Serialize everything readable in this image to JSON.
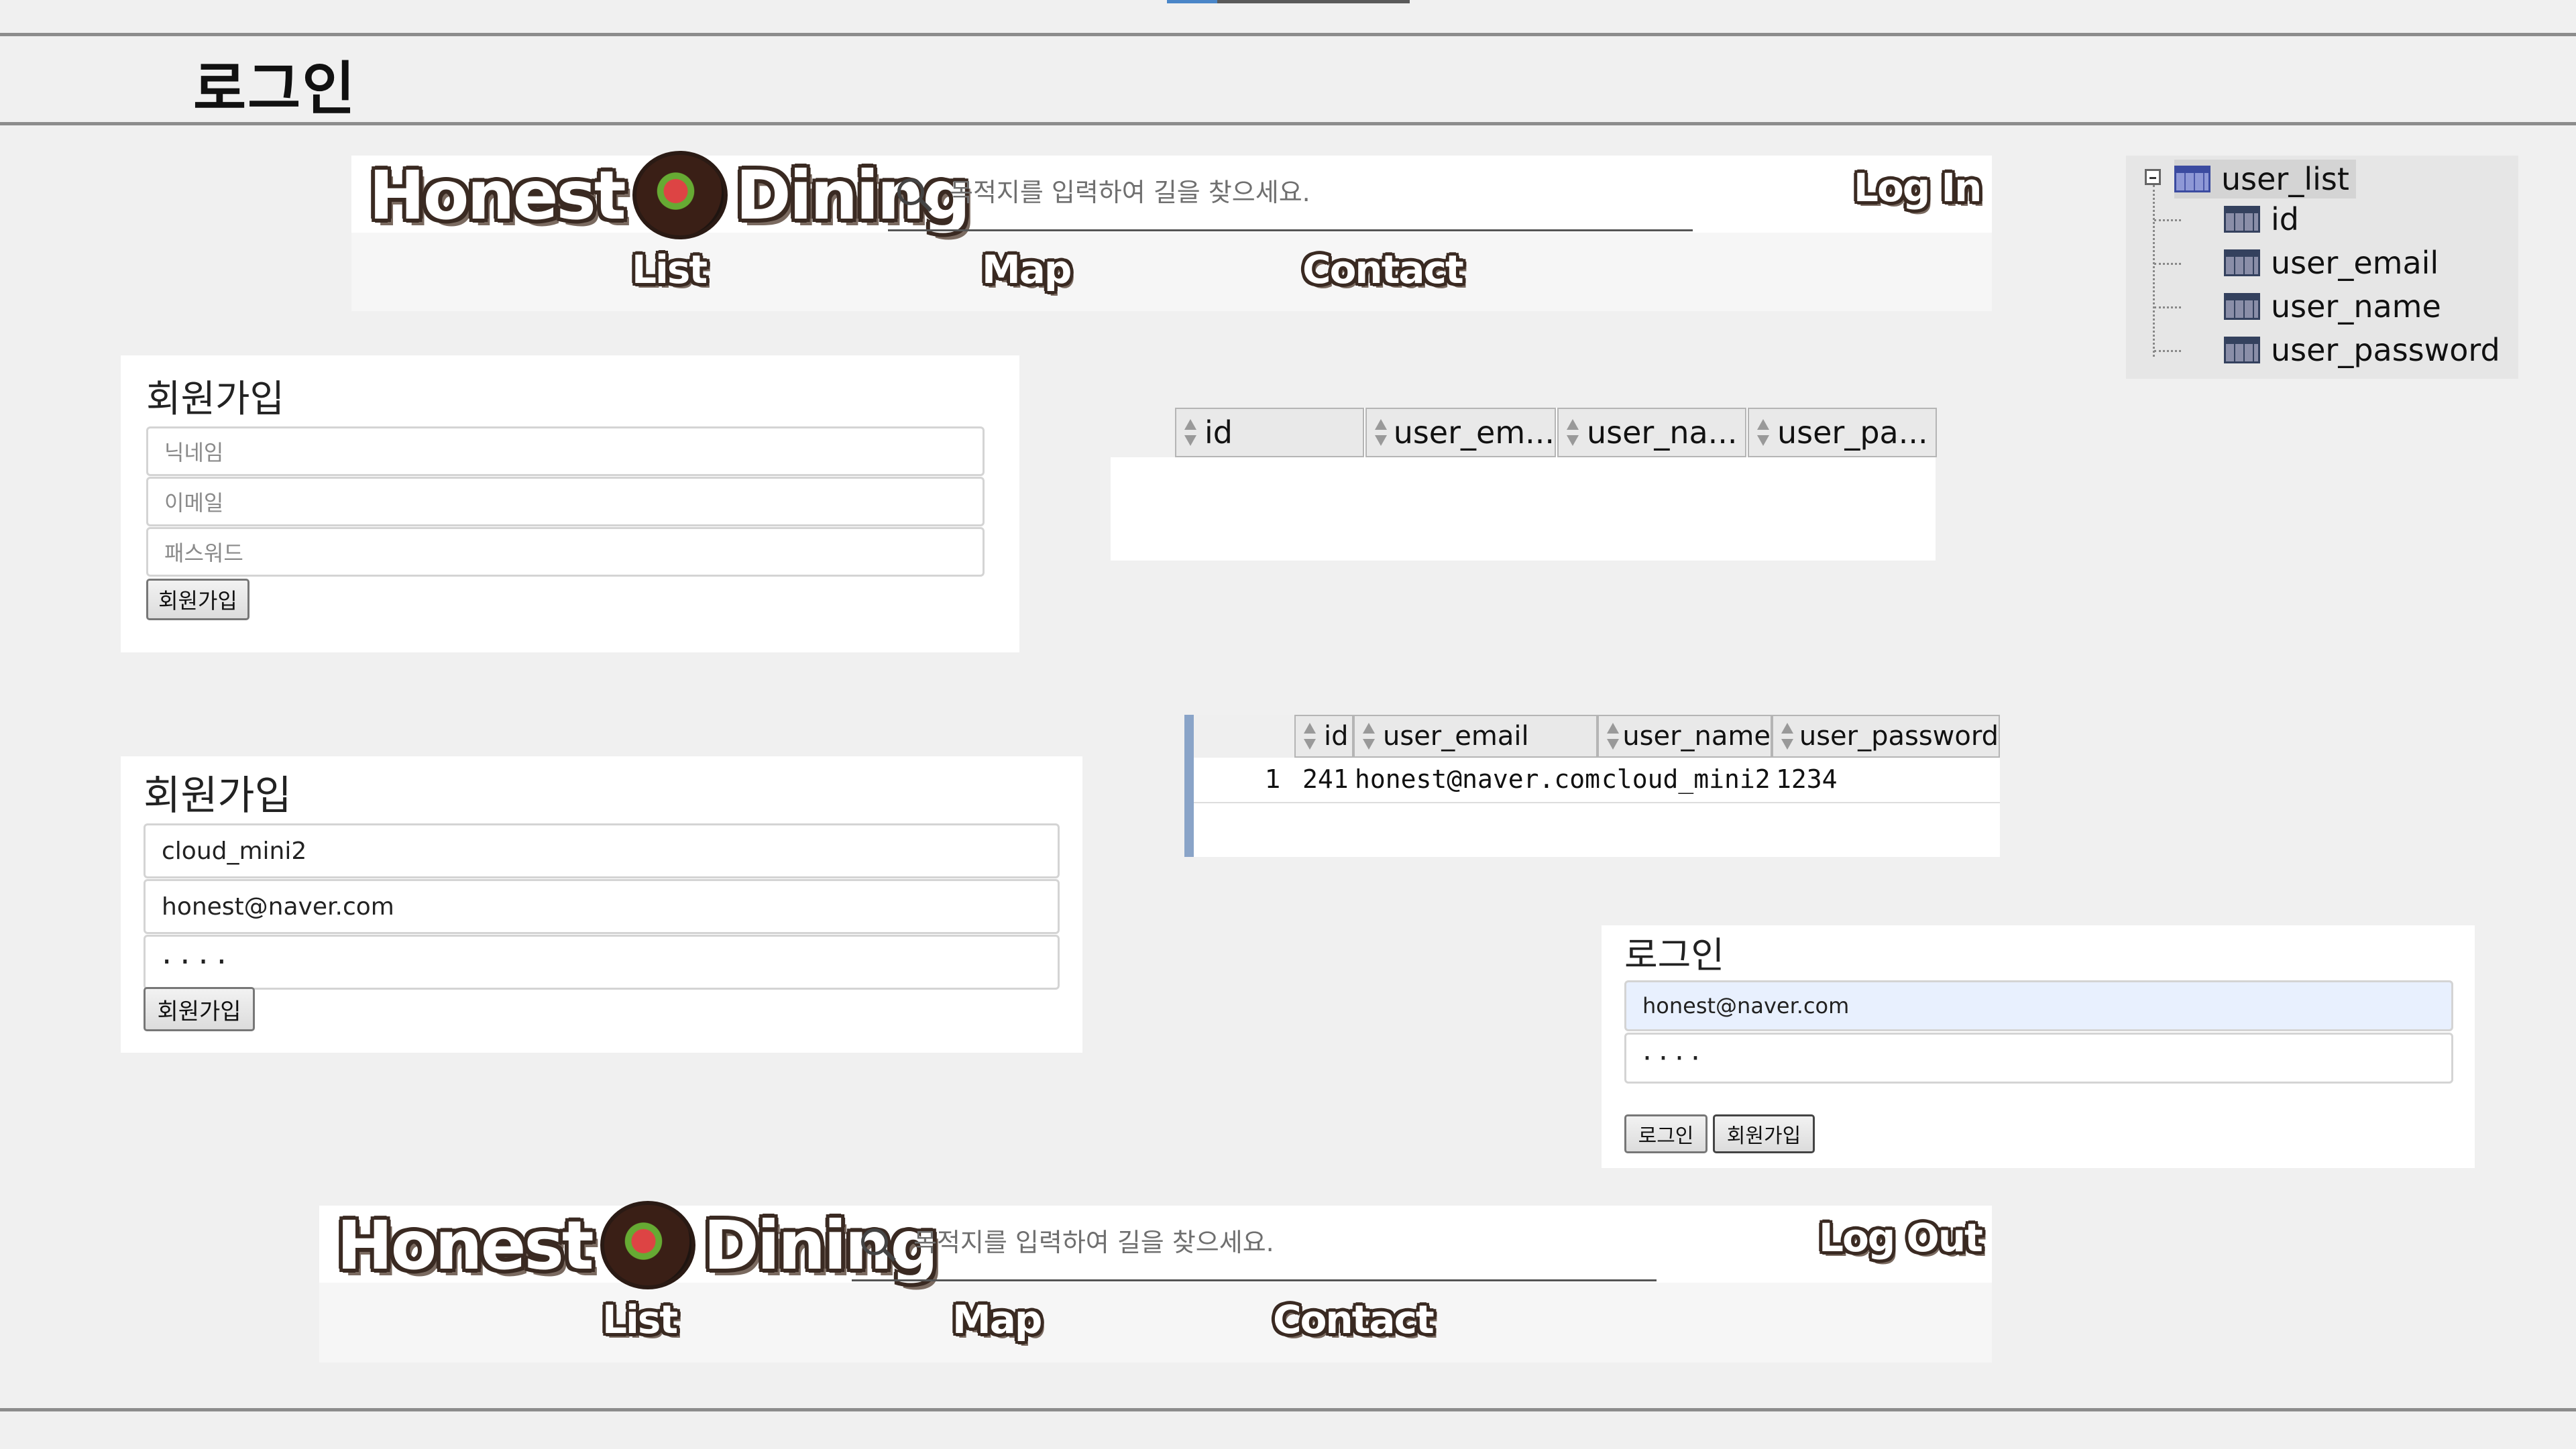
{
  "page": {
    "title": "로그인"
  },
  "nav_top": {
    "logo_left": "Honest",
    "logo_right": "Dining",
    "search_placeholder": "목적지를 입력하여 길을 찾으세요.",
    "auth_label": "Log In",
    "menu": [
      "List",
      "Map",
      "Contact"
    ]
  },
  "nav_bottom": {
    "logo_left": "Honest",
    "logo_right": "Dining",
    "search_placeholder": "목적지를 입력하여 길을 찾으세요.",
    "auth_label": "Log Out",
    "menu": [
      "List",
      "Map",
      "Contact"
    ]
  },
  "signup_empty": {
    "title": "회원가입",
    "nickname_placeholder": "닉네임",
    "email_placeholder": "이메일",
    "password_placeholder": "패스워드",
    "submit": "회원가입"
  },
  "signup_filled": {
    "title": "회원가입",
    "nickname": "cloud_mini2",
    "email": "honest@naver.com",
    "password": "····",
    "submit": "회원가입"
  },
  "login": {
    "title": "로그인",
    "email": "honest@naver.com",
    "password": "····",
    "login_button": "로그인",
    "signup_button": "회원가입"
  },
  "table_empty": {
    "headers": [
      "id",
      "user_em...",
      "user_na...",
      "user_pa..."
    ]
  },
  "table_filled": {
    "headers": [
      "id",
      "user_email",
      "user_name",
      "user_password"
    ],
    "rows": [
      {
        "num": "1",
        "id": "241",
        "user_email": "honest@naver.com",
        "user_name": "cloud_mini2",
        "user_password": "1234"
      }
    ]
  },
  "tree": {
    "table": "user_list",
    "columns": [
      "id",
      "user_email",
      "user_name",
      "user_password"
    ]
  }
}
